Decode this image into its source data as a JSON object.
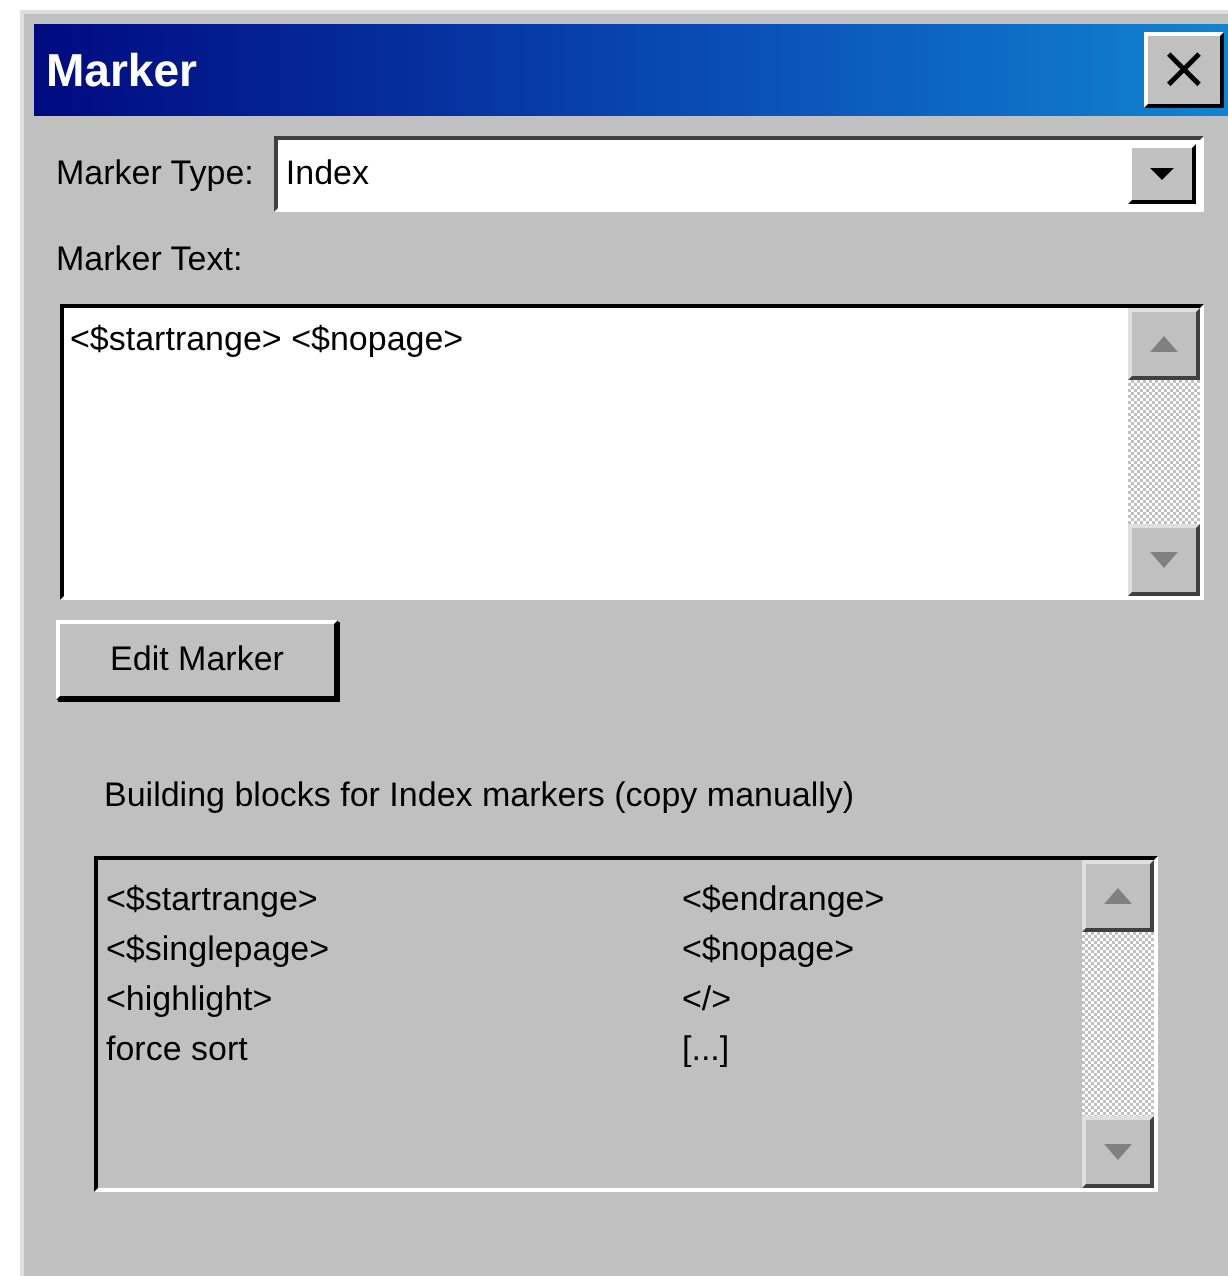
{
  "window": {
    "title": "Marker",
    "close": "×"
  },
  "marker_type": {
    "label": "Marker Type:",
    "value": "Index"
  },
  "marker_text": {
    "label": "Marker Text:",
    "value": "<$startrange> <$nopage>"
  },
  "edit_button": "Edit Marker",
  "building_blocks": {
    "caption": "Building blocks for Index markers (copy manually)",
    "rows": [
      [
        "<$startrange>",
        "<$endrange>"
      ],
      [
        "<$singlepage>",
        "<$nopage>"
      ],
      [
        "<highlight>",
        "</>"
      ],
      [
        "force sort",
        "[...]"
      ]
    ]
  }
}
